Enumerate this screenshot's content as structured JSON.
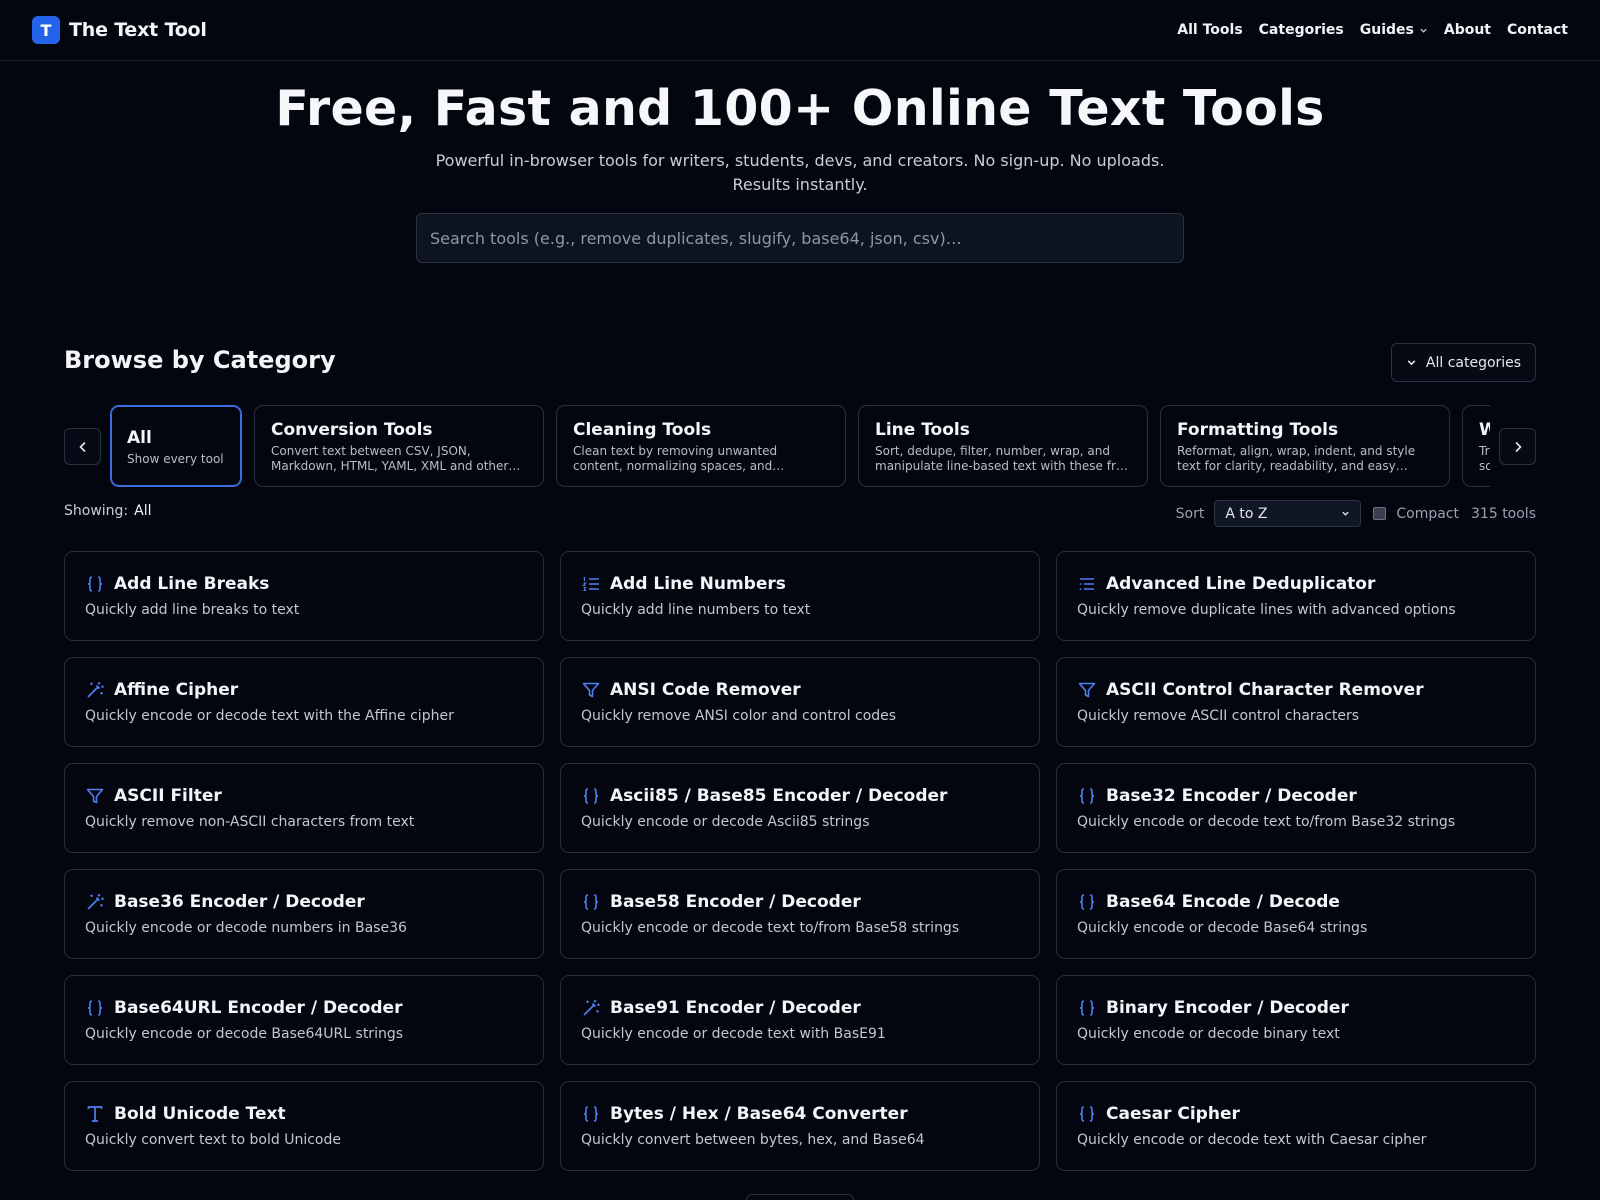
{
  "header": {
    "logo_letter": "T",
    "brand_name": "The Text Tool",
    "nav": [
      {
        "label": "All Tools"
      },
      {
        "label": "Categories"
      },
      {
        "label": "Guides"
      },
      {
        "label": "About"
      },
      {
        "label": "Contact"
      }
    ]
  },
  "hero": {
    "title": "Free, Fast and 100+ Online Text Tools",
    "subtitle": "Powerful in-browser tools for writers, students, devs, and creators. No sign-up. No uploads. Results instantly.",
    "search_placeholder": "Search tools (e.g., remove duplicates, slugify, base64, json, csv)…"
  },
  "browse": {
    "title": "Browse by Category",
    "all_categories_label": "All categories",
    "categories": [
      {
        "name": "All",
        "desc": "Show every tool",
        "active": true
      },
      {
        "name": "Conversion Tools",
        "desc": "Convert text between CSV, JSON, Markdown, HTML, YAML, XML and other…"
      },
      {
        "name": "Cleaning Tools",
        "desc": "Clean text by removing unwanted content, normalizing spaces, and…"
      },
      {
        "name": "Line Tools",
        "desc": "Sort, dedupe, filter, number, wrap, and manipulate line-based text with these fr…"
      },
      {
        "name": "Formatting Tools",
        "desc": "Reformat, align, wrap, indent, and style text for clarity, readability, and easy…"
      },
      {
        "name": "W",
        "desc": "Tr… so…"
      }
    ],
    "showing_label": "Showing:",
    "showing_value": "All",
    "sort_label": "Sort",
    "sort_value": "A to Z",
    "compact_label": "Compact",
    "count_label": "315 tools"
  },
  "tools": [
    {
      "icon": "braces-icon",
      "title": "Add Line Breaks",
      "desc": "Quickly add line breaks to text"
    },
    {
      "icon": "list-ordered-icon",
      "title": "Add Line Numbers",
      "desc": "Quickly add line numbers to text"
    },
    {
      "icon": "list-icon",
      "title": "Advanced Line Deduplicator",
      "desc": "Quickly remove duplicate lines with advanced options"
    },
    {
      "icon": "wand-icon",
      "title": "Affine Cipher",
      "desc": "Quickly encode or decode text with the Affine cipher"
    },
    {
      "icon": "filter-icon",
      "title": "ANSI Code Remover",
      "desc": "Quickly remove ANSI color and control codes"
    },
    {
      "icon": "filter-icon",
      "title": "ASCII Control Character Remover",
      "desc": "Quickly remove ASCII control characters"
    },
    {
      "icon": "filter-icon",
      "title": "ASCII Filter",
      "desc": "Quickly remove non-ASCII characters from text"
    },
    {
      "icon": "braces-icon",
      "title": "Ascii85 / Base85 Encoder / Decoder",
      "desc": "Quickly encode or decode Ascii85 strings"
    },
    {
      "icon": "braces-icon",
      "title": "Base32 Encoder / Decoder",
      "desc": "Quickly encode or decode text to/from Base32 strings"
    },
    {
      "icon": "wand-icon",
      "title": "Base36 Encoder / Decoder",
      "desc": "Quickly encode or decode numbers in Base36"
    },
    {
      "icon": "braces-icon",
      "title": "Base58 Encoder / Decoder",
      "desc": "Quickly encode or decode text to/from Base58 strings"
    },
    {
      "icon": "braces-icon",
      "title": "Base64 Encode / Decode",
      "desc": "Quickly encode or decode Base64 strings"
    },
    {
      "icon": "braces-icon",
      "title": "Base64URL Encoder / Decoder",
      "desc": "Quickly encode or decode Base64URL strings"
    },
    {
      "icon": "wand-icon",
      "title": "Base91 Encoder / Decoder",
      "desc": "Quickly encode or decode text with BasE91"
    },
    {
      "icon": "braces-icon",
      "title": "Binary Encoder / Decoder",
      "desc": "Quickly encode or decode binary text"
    },
    {
      "icon": "type-icon",
      "title": "Bold Unicode Text",
      "desc": "Quickly convert text to bold Unicode"
    },
    {
      "icon": "braces-icon",
      "title": "Bytes / Hex / Base64 Converter",
      "desc": "Quickly convert between bytes, hex, and Base64"
    },
    {
      "icon": "braces-icon",
      "title": "Caesar Cipher",
      "desc": "Quickly encode or decode text with Caesar cipher"
    }
  ],
  "colors": {
    "background": "#04060f",
    "accent": "#2563eb",
    "icon": "#4f7ff0",
    "border": "#262c3d"
  }
}
